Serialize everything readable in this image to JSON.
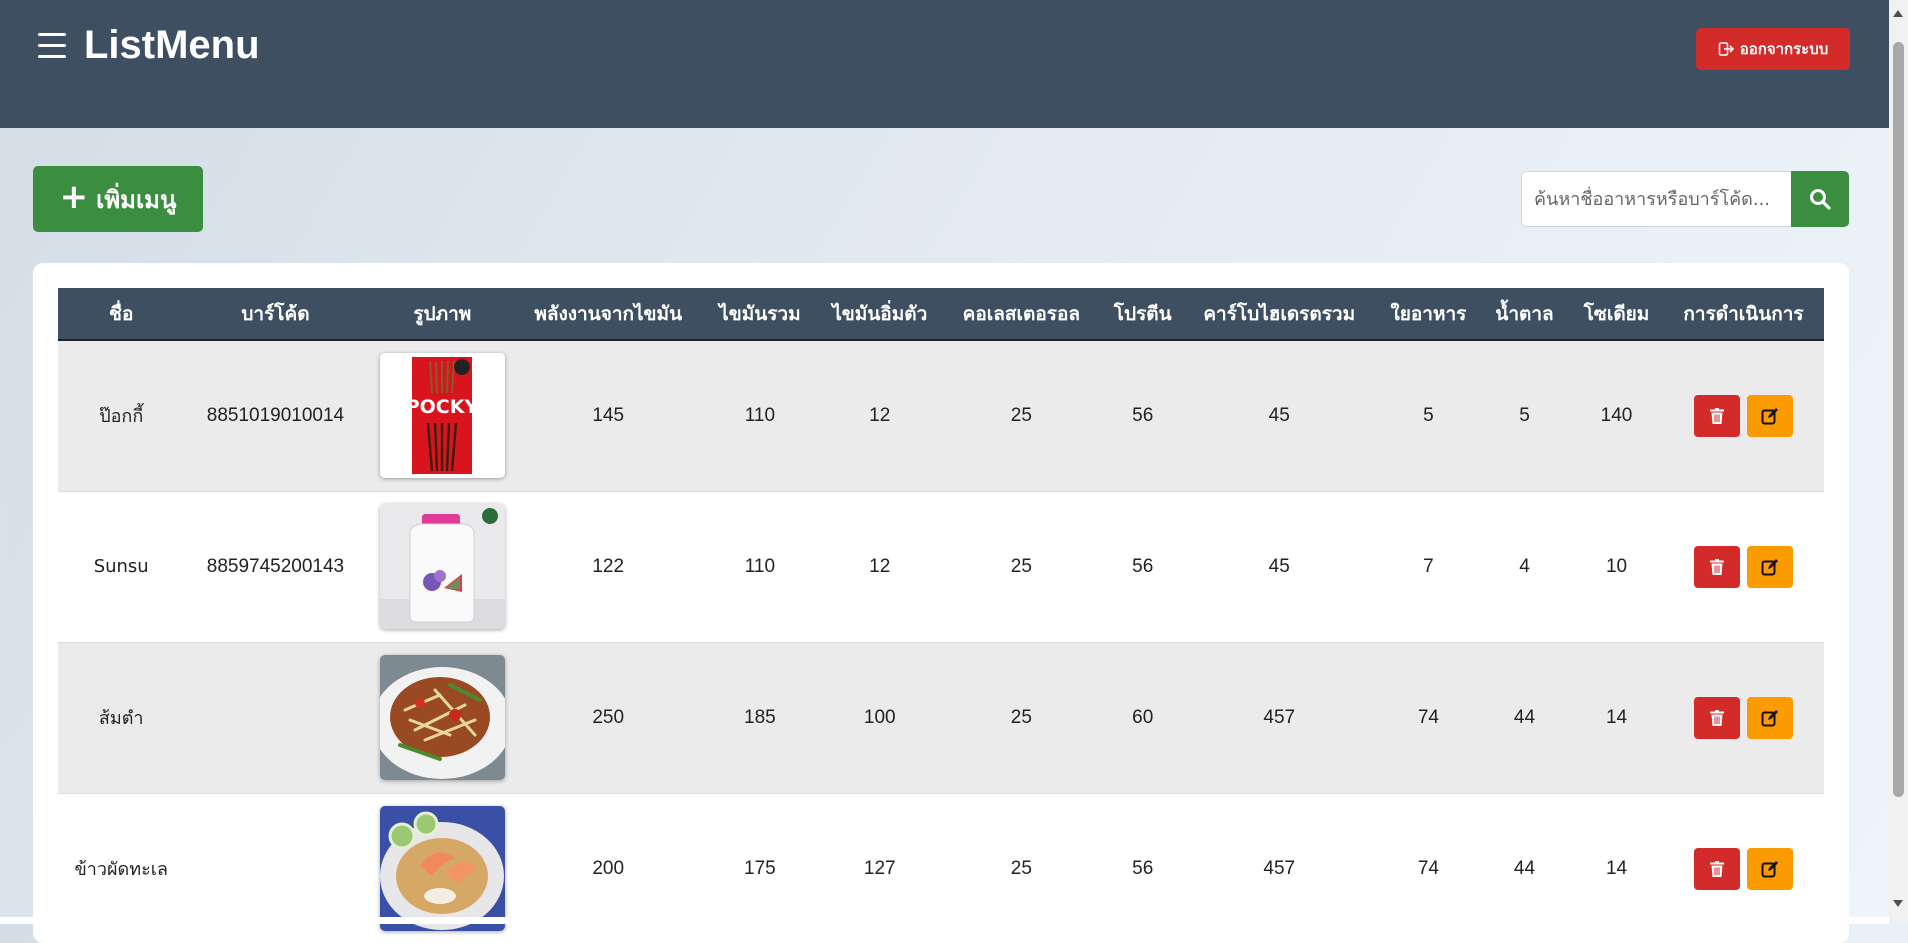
{
  "header": {
    "title": "ListMenu",
    "logout_label": "ออกจากระบบ",
    "menu_icon": "hamburger-icon",
    "logout_icon": "logout-icon"
  },
  "toolbar": {
    "add_label": "เพิ่มเมนู",
    "search_placeholder": "ค้นหาชื่ออาหารหรือบาร์โค้ด...",
    "search_icon": "search-icon"
  },
  "table": {
    "columns": [
      "ชื่อ",
      "บาร์โค้ด",
      "รูปภาพ",
      "พลังงานจากไขมัน",
      "ไขมันรวม",
      "ไขมันอิ่มตัว",
      "คอเลสเตอรอล",
      "โปรตีน",
      "คาร์โบไฮเดรตรวม",
      "ใยอาหาร",
      "น้ำตาล",
      "โซเดียม",
      "การดำเนินการ"
    ],
    "rows": [
      {
        "name": "ป๊อกกี้",
        "barcode": "8851019010014",
        "image": "pocky-product-photo",
        "fat_energy": "145",
        "total_fat": "110",
        "saturated_fat": "12",
        "cholesterol": "25",
        "protein": "56",
        "total_carb": "45",
        "fiber": "5",
        "sugar": "5",
        "sodium": "140"
      },
      {
        "name": "Sunsu",
        "barcode": "8859745200143",
        "image": "sunsu-product-photo",
        "fat_energy": "122",
        "total_fat": "110",
        "saturated_fat": "12",
        "cholesterol": "25",
        "protein": "56",
        "total_carb": "45",
        "fiber": "7",
        "sugar": "4",
        "sodium": "10"
      },
      {
        "name": "ส้มตำ",
        "barcode": "",
        "image": "somtam-dish-photo",
        "fat_energy": "250",
        "total_fat": "185",
        "saturated_fat": "100",
        "cholesterol": "25",
        "protein": "60",
        "total_carb": "457",
        "fiber": "74",
        "sugar": "44",
        "sodium": "14"
      },
      {
        "name": "ข้าวผัดทะเล",
        "barcode": "",
        "image": "seafood-fried-rice-photo",
        "fat_energy": "200",
        "total_fat": "175",
        "saturated_fat": "127",
        "cholesterol": "25",
        "protein": "56",
        "total_carb": "457",
        "fiber": "74",
        "sugar": "44",
        "sodium": "14"
      }
    ]
  },
  "colors": {
    "header_bg": "#3d4f61",
    "add_green": "#3b8d3f",
    "delete_red": "#d32a2a",
    "edit_orange": "#fb9b00"
  }
}
